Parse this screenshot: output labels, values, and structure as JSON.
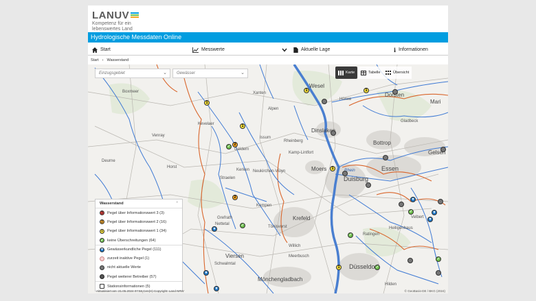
{
  "header": {
    "logo_text": "LANUV",
    "logo_tagline": "Kompetenz für ein lebenswertes Land",
    "app_title": "Hydrologische Messdaten Online"
  },
  "nav": {
    "items": [
      {
        "label": "Start",
        "icon": "home-icon"
      },
      {
        "label": "Messwerte",
        "icon": "chart-icon"
      },
      {
        "label": "Aktuelle Lage",
        "icon": "document-icon"
      },
      {
        "label": "Informationen",
        "icon": "info-icon"
      }
    ]
  },
  "breadcrumb": {
    "home": "Start",
    "current": "Wasserstand"
  },
  "filters": {
    "catchment_placeholder": "Einzugsgebiet",
    "water_placeholder": "Gewässer"
  },
  "view_toggle": {
    "map": "Karte",
    "table": "Tabelle",
    "overview": "Übersicht"
  },
  "legend": {
    "title": "Wasserstand",
    "items": [
      {
        "label": "Pegel über Informationswert 3 (3)",
        "symbol": "3",
        "color": "#e53935"
      },
      {
        "label": "Pegel über Informationswert 2 (16)",
        "symbol": "2",
        "color": "#f5a623"
      },
      {
        "label": "Pegel über Informationswert 1 (34)",
        "symbol": "1",
        "color": "#f7e13b"
      },
      {
        "label": "keine Überschreitungen (64)",
        "symbol": "✓",
        "color": "#6cc04a"
      },
      {
        "label": "Gewässerkundliche Pegel (111)",
        "symbol": "▼",
        "color": "#1f78c8"
      },
      {
        "label": "zurzeit inaktive Pegel (1)",
        "symbol": "",
        "color": "#f6cfcf"
      },
      {
        "label": "nicht aktuelle Werte",
        "symbol": "",
        "color": "#777777"
      },
      {
        "label": "Pegel weiterer Betreiber (57)",
        "symbol": "",
        "color": "#555555"
      },
      {
        "label": "Stationsinformationen (5)",
        "symbol": "",
        "color": "#ffffff"
      }
    ]
  },
  "map": {
    "attribution_left": "Aktualisiert am: 21.05.2024 07:58 Cen(H)  Copyright: Land NRW",
    "attribution_right": "© GeoBasis-DE / BKG (2024)",
    "labels": [
      {
        "text": "Wesel"
      },
      {
        "text": "Hünxe"
      },
      {
        "text": "Dorsten"
      },
      {
        "text": "Dinslaken"
      },
      {
        "text": "Gladbeck"
      },
      {
        "text": "Bottrop"
      },
      {
        "text": "Gelsen"
      },
      {
        "text": "Essen"
      },
      {
        "text": "Moers"
      },
      {
        "text": "Duisburg"
      },
      {
        "text": "Krefeld"
      },
      {
        "text": "Düsseldorf"
      },
      {
        "text": "Mönchengladbach"
      },
      {
        "text": "Viersen"
      },
      {
        "text": "Geldern"
      },
      {
        "text": "Kevelaer"
      },
      {
        "text": "Xanten"
      },
      {
        "text": "Rheinberg"
      },
      {
        "text": "Kamp-Lintfort"
      },
      {
        "text": "Neukirchen-Vluyn"
      },
      {
        "text": "Kerken"
      },
      {
        "text": "Straelen"
      },
      {
        "text": "Kempen"
      },
      {
        "text": "Tönisvorst"
      },
      {
        "text": "Willich"
      },
      {
        "text": "Meerbusch"
      },
      {
        "text": "Ratingen"
      },
      {
        "text": "Velbert"
      },
      {
        "text": "Heiligenhaus"
      },
      {
        "text": "Hilden"
      },
      {
        "text": "Grefrath"
      },
      {
        "text": "Nettetal"
      },
      {
        "text": "Schwalmtal"
      },
      {
        "text": "Venray"
      },
      {
        "text": "Horst"
      },
      {
        "text": "Deurne"
      },
      {
        "text": "Boxmeer"
      },
      {
        "text": "Issum"
      },
      {
        "text": "Alpen"
      },
      {
        "text": "Mari"
      },
      {
        "text": "Rhein"
      }
    ]
  }
}
